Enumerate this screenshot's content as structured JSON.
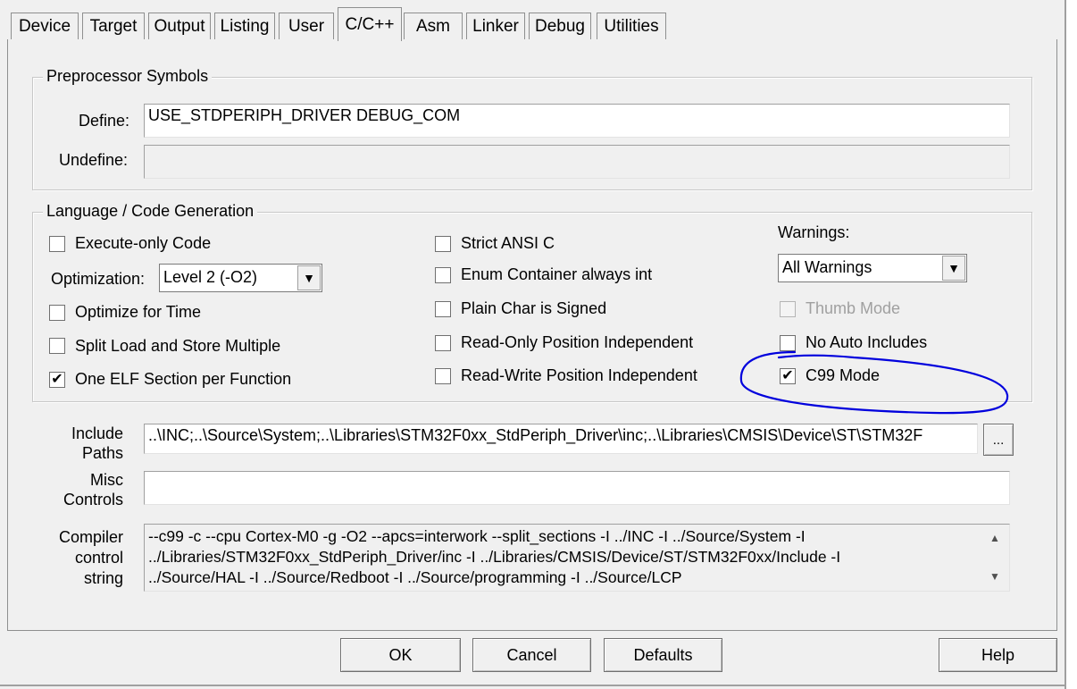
{
  "tabs": [
    "Device",
    "Target",
    "Output",
    "Listing",
    "User",
    "C/C++",
    "Asm",
    "Linker",
    "Debug",
    "Utilities"
  ],
  "active_tab": "C/C++",
  "preprocessor": {
    "title": "Preprocessor Symbols",
    "define_label": "Define:",
    "define_value": "USE_STDPERIPH_DRIVER DEBUG_COM",
    "undefine_label": "Undefine:",
    "undefine_value": ""
  },
  "language": {
    "title": "Language / Code Generation",
    "execute_only": {
      "label": "Execute-only Code",
      "checked": false
    },
    "optimization_label": "Optimization:",
    "optimization_value": "Level 2 (-O2)",
    "optimize_time": {
      "label": "Optimize for Time",
      "checked": false
    },
    "split_load": {
      "label": "Split Load and Store Multiple",
      "checked": false
    },
    "one_elf": {
      "label": "One ELF Section per Function",
      "checked": true
    },
    "strict_ansi": {
      "label": "Strict ANSI C",
      "checked": false
    },
    "enum_container": {
      "label": "Enum Container always int",
      "checked": false
    },
    "plain_char": {
      "label": "Plain Char is Signed",
      "checked": false
    },
    "ro_pos": {
      "label": "Read-Only Position Independent",
      "checked": false
    },
    "rw_pos": {
      "label": "Read-Write Position Independent",
      "checked": false
    },
    "warnings_label": "Warnings:",
    "warnings_value": "All Warnings",
    "thumb_mode": {
      "label": "Thumb Mode",
      "checked": false,
      "disabled": true
    },
    "no_auto_includes": {
      "label": "No Auto Includes",
      "checked": false
    },
    "c99_mode": {
      "label": "C99 Mode",
      "checked": true
    }
  },
  "include_paths": {
    "label_line1": "Include",
    "label_line2": "Paths",
    "value": "..\\INC;..\\Source\\System;..\\Libraries\\STM32F0xx_StdPeriph_Driver\\inc;..\\Libraries\\CMSIS\\Device\\ST\\STM32F",
    "browse_label": "..."
  },
  "misc_controls": {
    "label_line1": "Misc",
    "label_line2": "Controls",
    "value": ""
  },
  "compiler_string": {
    "label_line1": "Compiler",
    "label_line2": "control",
    "label_line3": "string",
    "line1": "--c99 -c --cpu Cortex-M0 -g -O2 --apcs=interwork --split_sections -I ../INC -I ../Source/System -I",
    "line2": "../Libraries/STM32F0xx_StdPeriph_Driver/inc -I ../Libraries/CMSIS/Device/ST/STM32F0xx/Include -I",
    "line3": "../Source/HAL -I ../Source/Redboot -I ../Source/programming -I ../Source/LCP"
  },
  "buttons": {
    "ok": "OK",
    "cancel": "Cancel",
    "defaults": "Defaults",
    "help": "Help"
  },
  "colors": {
    "annotation": "#0000dd",
    "window_bg": "#f0f0f0"
  },
  "icons": {
    "checkmark": "check-icon",
    "dropdown": "chevron-down-icon",
    "scroll_up": "scroll-up-icon",
    "scroll_down": "scroll-down-icon"
  }
}
